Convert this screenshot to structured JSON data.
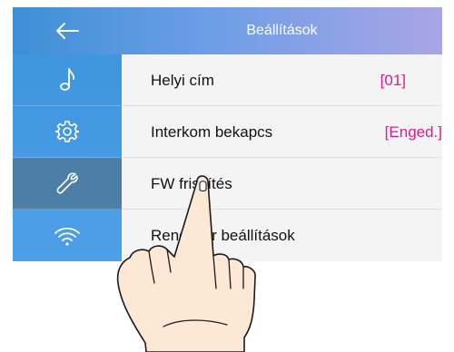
{
  "header": {
    "title": "Beállítások",
    "back_icon": "arrow-left-icon"
  },
  "sidebar": {
    "items": [
      {
        "icon": "music-note-icon",
        "active": false
      },
      {
        "icon": "gear-icon",
        "active": false
      },
      {
        "icon": "wrench-icon",
        "active": true
      },
      {
        "icon": "wifi-icon",
        "active": false
      }
    ]
  },
  "settings": {
    "rows": [
      {
        "label": "Helyi cím",
        "value": "[01]"
      },
      {
        "label": "Interkom bekapcs",
        "value": "[Enged.]"
      },
      {
        "label": "FW frissítés",
        "value": ""
      },
      {
        "label": "Rendszer beállítások",
        "value": ""
      }
    ]
  },
  "colors": {
    "accent": "#e0198c",
    "header_start": "#3d8fd6",
    "header_end": "#a9a5e6",
    "sidebar": "#4a9be4",
    "sidebar_active": "#4d7ea8"
  },
  "overlay": {
    "pointer_icon": "pointing-hand-icon"
  }
}
